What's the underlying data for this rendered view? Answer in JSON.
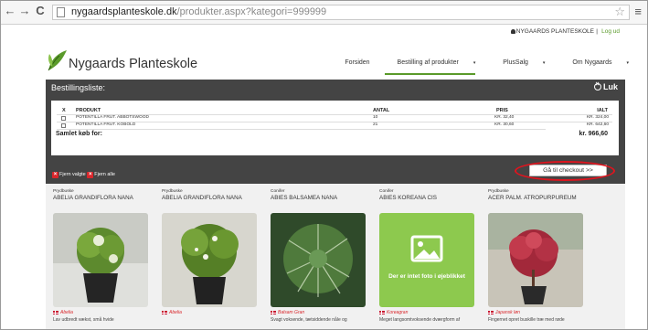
{
  "browser": {
    "back": "←",
    "forward": "→",
    "reload": "C",
    "url_host": "nygaardsplanteskole.dk",
    "url_path": "/produkter.aspx?kategori=999999"
  },
  "userbar": {
    "user": "NYGAARDS PLANTESKOLE",
    "separator": "|",
    "logout": "Log ud"
  },
  "brand": {
    "name": "Nygaards Planteskole"
  },
  "nav": {
    "items": [
      {
        "label": "Forsiden"
      },
      {
        "label": "Bestilling af produkter",
        "caret": "▾"
      },
      {
        "label": "PlusSalg",
        "caret": "▾"
      },
      {
        "label": "Om Nygaards",
        "caret": "▾"
      }
    ]
  },
  "order": {
    "title": "Bestillingsliste:",
    "close_label": "Luk",
    "columns": {
      "x": "X",
      "product": "PRODUKT",
      "qty": "ANTAL",
      "price": "PRIS",
      "total": "IALT"
    },
    "rows": [
      {
        "product": "POTENTILLA FRUT. ABBOTSWOOD",
        "qty": "10",
        "price": "kr. 32,40",
        "total": "kr. 324,00"
      },
      {
        "product": "POTENTILLA FRUT. KOBOLD",
        "qty": "21",
        "price": "kr. 30,60",
        "total": "kr. 642,60"
      }
    ],
    "sum_label": "Samlet køb for:",
    "sum_value": "kr. 966,60",
    "remove_selected": "Fjern valgte",
    "remove_all": "Fjern alle",
    "checkout": "Gå til checkout >>"
  },
  "products": [
    {
      "category": "Prydbuske",
      "name": "ABELIA GRANDIFLORA NANA",
      "latin": "Abelia",
      "desc": "Lav udbredt vækst, små hvide"
    },
    {
      "category": "Prydbuske",
      "name": "ABELIA GRANDIFLORA NANA",
      "latin": "Abelia",
      "desc": ""
    },
    {
      "category": "Conifer",
      "name": "ABIES BALSAMEA NANA",
      "latin": "Balsam Gran",
      "desc": "Svagt voksende, tætsiddende nåle og"
    },
    {
      "category": "Conifer",
      "name": "ABIES KOREANA CIS",
      "latin": "Koreagran",
      "desc": "Meget langsomtvoksende dværgform af",
      "no_image": "Der er intet foto i øjeblikket"
    },
    {
      "category": "Prydbuske",
      "name": "ACER PALM. ATROPURPUREUM",
      "latin": "Japansk løn",
      "desc": "Fingernet opret buskille træ med røde"
    }
  ],
  "colors": {
    "accent": "#5a9a2a",
    "panel": "#444444",
    "highlight": "#e0141e",
    "danish_red": "#c8102e"
  }
}
